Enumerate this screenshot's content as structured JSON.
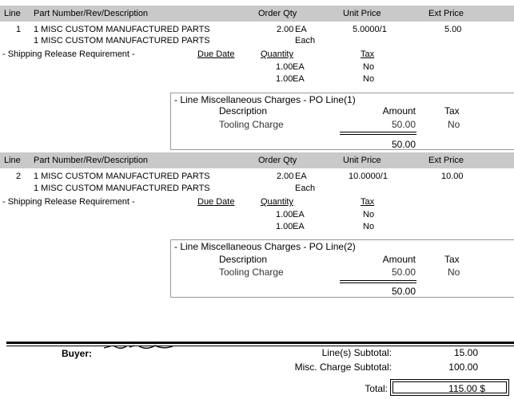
{
  "headers": {
    "line": "Line",
    "part": "Part Number/Rev/Description",
    "order_qty": "Order Qty",
    "unit_price": "Unit Price",
    "ext_price": "Ext Price"
  },
  "lines": [
    {
      "num": "1",
      "part": "1 MISC CUSTOM MANUFACTURED PARTS",
      "description": "1 MISC CUSTOM MANUFACTURED PARTS",
      "qty": "2.00",
      "uom": "EA",
      "uom_desc": "Each",
      "unit_price": "5.0000/1",
      "ext_price": "5.00",
      "shipping_label": "- Shipping Release Requirement -",
      "ship_headers": {
        "due_date": "Due Date",
        "quantity": "Quantity",
        "tax": "Tax"
      },
      "releases": [
        {
          "qty": "1.00",
          "uom": "EA",
          "tax": "No"
        },
        {
          "qty": "1.00",
          "uom": "EA",
          "tax": "No"
        }
      ],
      "misc": {
        "title": "- Line Miscellaneous Charges - PO Line(1)",
        "col_description": "Description",
        "col_amount": "Amount",
        "col_tax": "Tax",
        "item_description": "Tooling Charge",
        "item_amount": "50.00",
        "item_tax": "No",
        "total": "50.00"
      }
    },
    {
      "num": "2",
      "part": "1 MISC CUSTOM MANUFACTURED PARTS",
      "description": "1 MISC CUSTOM MANUFACTURED PARTS",
      "qty": "2.00",
      "uom": "EA",
      "uom_desc": "Each",
      "unit_price": "10.0000/1",
      "ext_price": "10.00",
      "shipping_label": "- Shipping Release Requirement -",
      "ship_headers": {
        "due_date": "Due Date",
        "quantity": "Quantity",
        "tax": "Tax"
      },
      "releases": [
        {
          "qty": "1.00",
          "uom": "EA",
          "tax": "No"
        },
        {
          "qty": "1.00",
          "uom": "EA",
          "tax": "No"
        }
      ],
      "misc": {
        "title": "- Line Miscellaneous Charges - PO Line(2)",
        "col_description": "Description",
        "col_amount": "Amount",
        "col_tax": "Tax",
        "item_description": "Tooling Charge",
        "item_amount": "50.00",
        "item_tax": "No",
        "total": "50.00"
      }
    }
  ],
  "footer": {
    "buyer_label": "Buyer:",
    "lines_subtotal_label": "Line(s) Subtotal:",
    "lines_subtotal": "15.00",
    "misc_subtotal_label": "Misc. Charge Subtotal:",
    "misc_subtotal": "100.00",
    "total_label": "Total:",
    "total": "115.00 $"
  }
}
